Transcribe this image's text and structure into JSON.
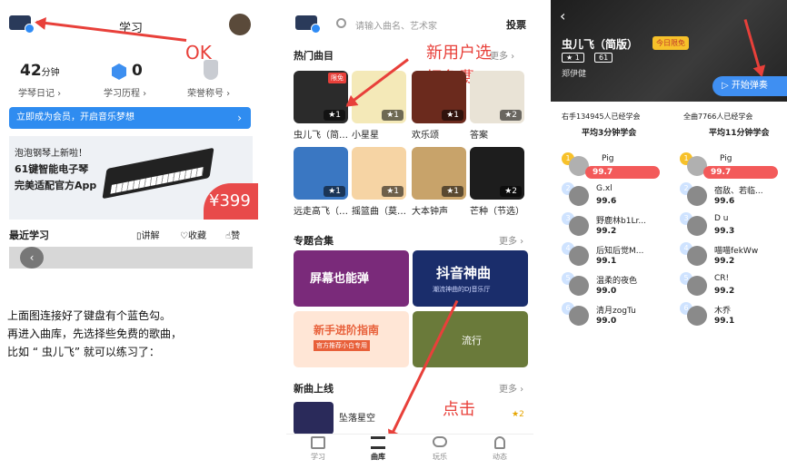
{
  "p1": {
    "title": "学习",
    "ok": "OK",
    "stats": [
      {
        "value": "42",
        "unit": "分钟",
        "label": "学琴日记 ›"
      },
      {
        "value": "0",
        "label": "学习历程 ›"
      },
      {
        "label": "荣誉称号 ›"
      }
    ],
    "member_bar": "立即成为会员，开启音乐梦想",
    "banner": {
      "line1": "泡泡钢琴上新啦！",
      "line2": "61键智能电子琴",
      "line3": "完美适配官方App",
      "price": "¥399"
    },
    "recent": "最近学习",
    "actions": [
      "讲解",
      "收藏",
      "赞"
    ]
  },
  "p2": {
    "search_placeholder": "请输入曲名、艺术家",
    "vote": "投票",
    "hot": "热门曲目",
    "more": "更多 ›",
    "annot_new": "新用户选",
    "annot_free": "择免费",
    "free_badge": "限免",
    "songs": [
      {
        "name": "虫儿飞（简…",
        "stars": "★1",
        "bg": "#2b2b2b"
      },
      {
        "name": "小星星",
        "stars": "★1",
        "bg": "#f4e9b8"
      },
      {
        "name": "欢乐颂",
        "stars": "★1",
        "bg": "#6b2a1d"
      },
      {
        "name": "答案",
        "stars": "★2",
        "bg": "#e9e3d6"
      },
      {
        "name": "远走高飞（…",
        "stars": "★1",
        "bg": "#3a77c2"
      },
      {
        "name": "摇篮曲（莫…",
        "stars": "★1",
        "bg": "#f6d4a4"
      },
      {
        "name": "大本钟声",
        "stars": "★1",
        "bg": "#c8a36a"
      },
      {
        "name": "芒种（节选）",
        "stars": "★2",
        "bg": "#1d1d1d"
      }
    ],
    "collections": "专题合集",
    "coll_more": "更多 ›",
    "coll_tiles": [
      {
        "text": "屏幕也能弹",
        "bg": "#7a2a7a"
      },
      {
        "text": "抖音神曲",
        "sub": "潮流神曲的DJ音乐厅",
        "bg": "#1a2d6b"
      },
      {
        "text": "新手进阶指南",
        "sub": "官方推荐小白专用",
        "bg": "#ffe6d6"
      },
      {
        "text": "流行",
        "bg": "#6a7a3a"
      }
    ],
    "new_songs": "新曲上线",
    "new_more": "更多 ›",
    "new_song": "坠落星空",
    "new_stars": "★2",
    "annot_click": "点击",
    "tabs": [
      "学习",
      "曲库",
      "玩乐",
      "动态"
    ]
  },
  "p3": {
    "song": "虫儿飞（简版）",
    "badge": "今日限免",
    "stars": "★ 1",
    "keys": "61",
    "artist": "郑伊健",
    "start": "开始弹奏",
    "left_head": "右手134945人已经学会",
    "left_avg": "平均3分钟学会",
    "right_head": "全曲7766人已经学会",
    "right_avg": "平均11分钟学会",
    "left": [
      {
        "rank": "1",
        "name": "Pig",
        "score": "99.7"
      },
      {
        "rank": "2",
        "name": "G.xl",
        "score": "99.6"
      },
      {
        "rank": "3",
        "name": "野鹿林b1Lr...",
        "score": "99.2"
      },
      {
        "rank": "4",
        "name": "后知后觉M...",
        "score": "99.1"
      },
      {
        "rank": "5",
        "name": "温柔的夜色",
        "score": "99.0"
      },
      {
        "rank": "6",
        "name": "清月zogTu",
        "score": "99.0"
      }
    ],
    "right": [
      {
        "rank": "1",
        "name": "Pig",
        "score": "99.7"
      },
      {
        "rank": "2",
        "name": "宿敌、若临...",
        "score": "99.6"
      },
      {
        "rank": "3",
        "name": "D u",
        "score": "99.3"
      },
      {
        "rank": "4",
        "name": "喵喵fekWw",
        "score": "99.2"
      },
      {
        "rank": "5",
        "name": "CR!",
        "score": "99.2"
      },
      {
        "rank": "6",
        "name": "木乔",
        "score": "99.1"
      }
    ]
  },
  "caption": [
    "上面图连接好了键盘有个蓝色勾。",
    "再进入曲库，先选择些免费的歌曲，",
    "比如 “ 虫儿飞” 就可以练习了："
  ]
}
